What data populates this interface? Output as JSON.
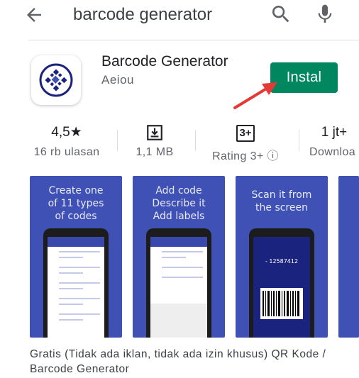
{
  "search": {
    "query": "barcode generator"
  },
  "app": {
    "title": "Barcode Generator",
    "developer": "Aeiou",
    "install_label": "Instal"
  },
  "stats": [
    {
      "top": "4,5★",
      "bottom": "16 rb ulasan"
    },
    {
      "top": "",
      "bottom": "1,1 MB"
    },
    {
      "top": "3+",
      "bottom": "Rating 3+ ⓘ"
    },
    {
      "top": "1 jt+",
      "bottom": "Downloa"
    }
  ],
  "screenshots": [
    {
      "caption": "Create one\nof 11 types\nof codes"
    },
    {
      "caption": "Add code\nDescribe it\nAdd labels"
    },
    {
      "caption": "Scan it from\nthe screen",
      "code": "- 12587412"
    }
  ],
  "description": "Gratis (Tidak ada iklan, tidak ada izin khusus) QR Kode / Barcode Generator",
  "colors": {
    "install": "#01875f",
    "screenshot_bg": "#3f51b5",
    "arrow": "#e53935"
  }
}
